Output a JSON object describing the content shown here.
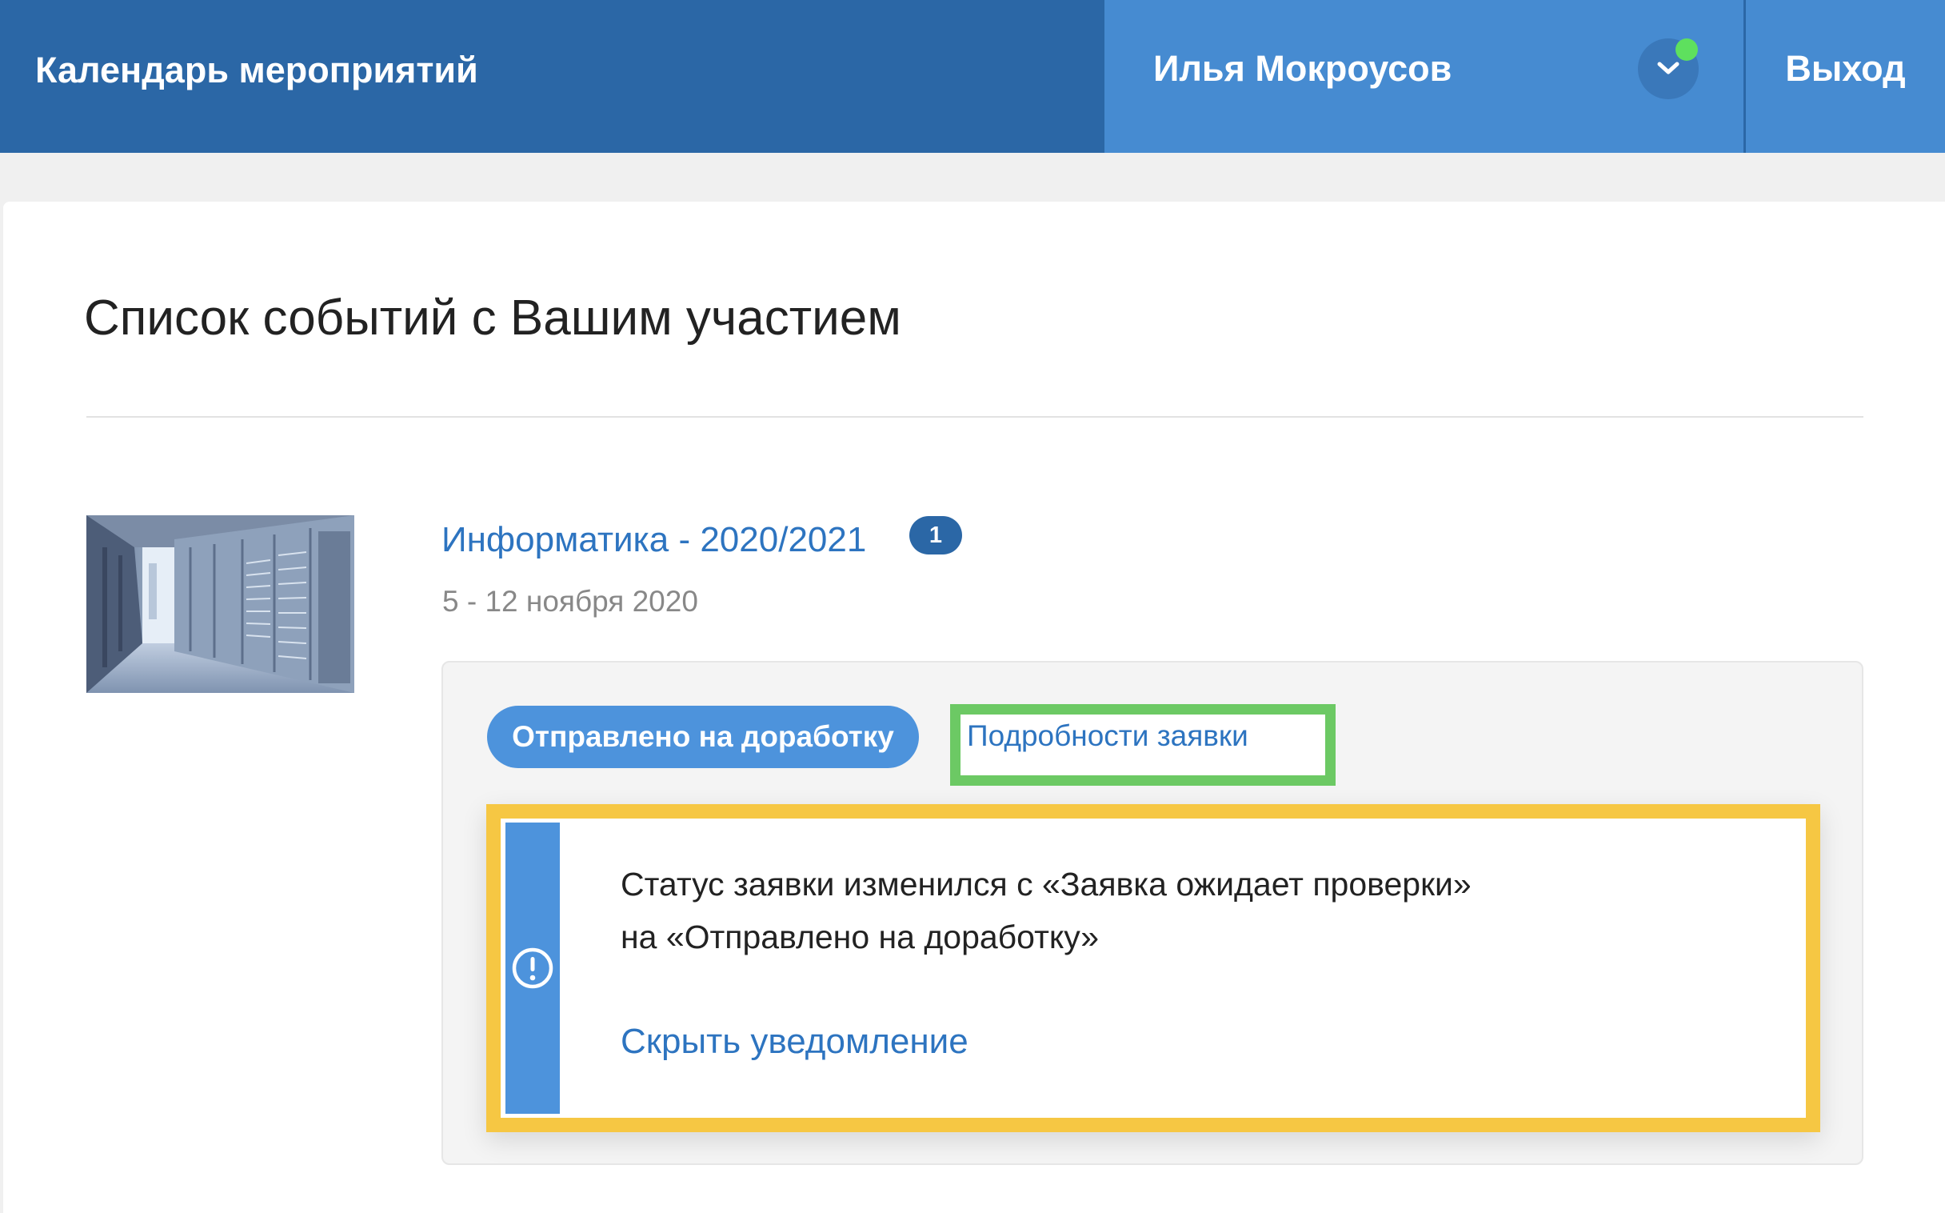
{
  "header": {
    "brand": "Календарь мероприятий",
    "user_name": "Илья Мокроусов",
    "logout_label": "Выход"
  },
  "page": {
    "title": "Список событий с Вашим участием"
  },
  "event": {
    "title": "Информатика - 2020/2021",
    "badge_count": "1",
    "dates": "5 - 12 ноября 2020",
    "thumbnail": "server-room-image",
    "application": {
      "status_label": "Отправлено на доработку",
      "details_link": "Подробности заявки",
      "notification": {
        "line1": "Статус заявки изменился с «Заявка ожидает проверки»",
        "line2": "на «Отправлено на доработку»",
        "hide_link": "Скрыть уведомление",
        "icon": "exclamation-circle-icon"
      }
    }
  },
  "colors": {
    "header_bg": "#2b67a6",
    "user_panel_bg": "#468bd1",
    "accent_blue": "#4d93dc",
    "link_blue": "#2d74c0",
    "highlight_green": "#6cc964",
    "highlight_yellow": "#f6c743",
    "online_green": "#5ee05e"
  }
}
